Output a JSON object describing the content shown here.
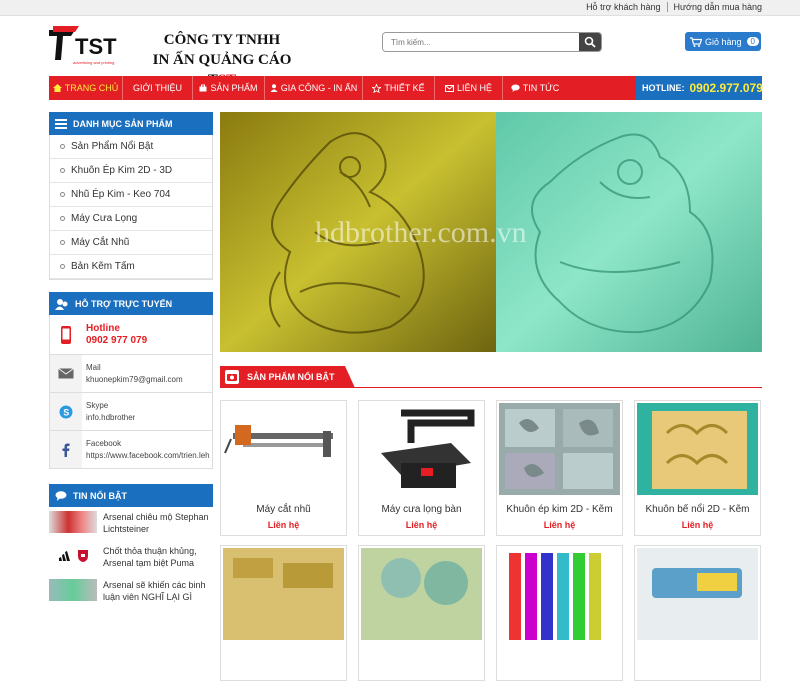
{
  "topbar": {
    "support": "Hỗ trợ khách hàng",
    "guide": "Hướng dẫn mua hàng"
  },
  "header": {
    "logo_text": "TST",
    "logo_tagline": "advertising and printing",
    "company_line1": "CÔNG TY TNHH",
    "company_line2": "IN ẤN QUẢNG CÁO T",
    "company_line2_red": "ST",
    "search_placeholder": "Tìm kiếm...",
    "cart_label": "Giỏ hàng",
    "cart_count": "0"
  },
  "nav": {
    "items": [
      {
        "label": "TRANG CHỦ",
        "icon": "home-icon"
      },
      {
        "label": "GIỚI THIỆU",
        "icon": ""
      },
      {
        "label": "SẢN PHẨM",
        "icon": "bag-icon"
      },
      {
        "label": "GIA CÔNG - IN ẤN",
        "icon": "user-icon"
      },
      {
        "label": "THIẾT KẾ",
        "icon": "star-icon"
      },
      {
        "label": "LIÊN HỆ",
        "icon": "mail-icon"
      },
      {
        "label": "TIN TỨC",
        "icon": "chat-icon"
      }
    ],
    "hotline_label": "HOTLINE:",
    "hotline_number": "0902.977.079"
  },
  "sidebar": {
    "categories_title": "DANH MỤC SẢN PHẨM",
    "categories": [
      "Sản Phẩm Nổi Bật",
      "Khuôn Ép Kim 2D - 3D",
      "Nhũ Ép Kim - Keo 704",
      "Máy Cưa Lọng",
      "Máy Cắt Nhũ",
      "Bản Kẽm Tấm"
    ],
    "support_title": "HỖ TRỢ TRỰC TUYẾN",
    "hotline_label": "Hotline",
    "hotline_number": "0902 977 079",
    "mail_label": "Mail",
    "mail_value": "khuonepkim79@gmail.com",
    "skype_label": "Skype",
    "skype_value": "info.hdbrother",
    "facebook_label": "Facebook",
    "facebook_value": "https://www.facebook.com/trien.leh",
    "news_title": "TIN NỔI BẬT",
    "news": [
      "Arsenal chiêu mộ Stephan Lichtsteiner",
      "Chốt thỏa thuận khủng, Arsenal tạm biệt Puma",
      "Arsenal sẽ khiến các binh luận viên NGHĨ LẠI GÌ"
    ]
  },
  "banner": {
    "watermark": "hdbrother.com.vn"
  },
  "featured": {
    "title": "SẢN PHẨM NỔI BẬT",
    "products": [
      {
        "name": "Máy cắt nhũ",
        "price": "Liên hệ"
      },
      {
        "name": "Máy cưa lọng bàn",
        "price": "Liên hệ"
      },
      {
        "name": "Khuôn ép kim 2D - Kẽm",
        "price": "Liên hệ"
      },
      {
        "name": "Khuôn bế nổi 2D - Kẽm",
        "price": "Liên hệ"
      },
      {
        "name": "",
        "price": ""
      },
      {
        "name": "",
        "price": ""
      },
      {
        "name": "",
        "price": ""
      },
      {
        "name": "",
        "price": ""
      }
    ]
  },
  "colors": {
    "brand_red": "#e31e24",
    "brand_blue": "#1a6fbf",
    "hotline_yellow": "#ffeb3b"
  }
}
